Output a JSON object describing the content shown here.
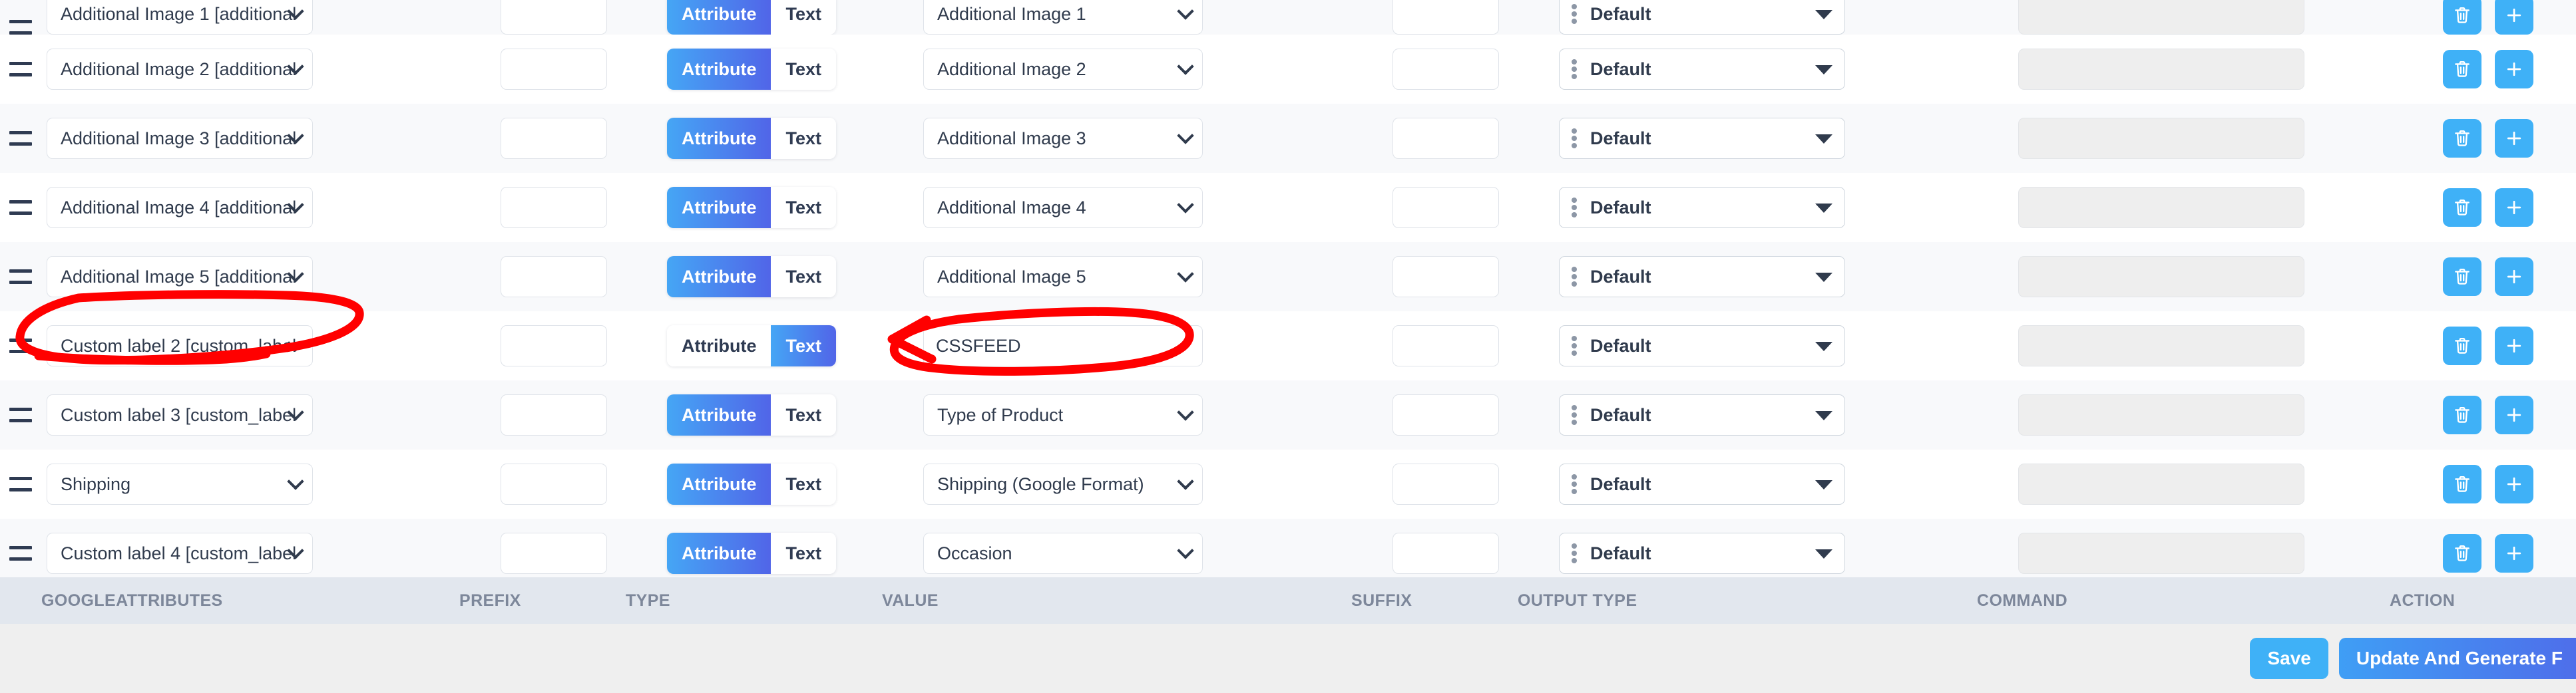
{
  "table": {
    "columns": [
      {
        "key": "attributes",
        "label": "GOOGLEATTRIBUTES"
      },
      {
        "key": "prefix",
        "label": "PREFIX"
      },
      {
        "key": "type",
        "label": "TYPE"
      },
      {
        "key": "value",
        "label": "VALUE"
      },
      {
        "key": "suffix",
        "label": "SUFFIX"
      },
      {
        "key": "output_type",
        "label": "OUTPUT TYPE"
      },
      {
        "key": "command",
        "label": "COMMAND"
      },
      {
        "key": "action",
        "label": "ACTION"
      }
    ],
    "toggle": {
      "attribute_label": "Attribute",
      "text_label": "Text"
    },
    "output_type_default": "Default",
    "rows": [
      {
        "attribute": "Additional Image 1 [additional",
        "prefix": "",
        "type_active": "Attribute",
        "value": "Additional Image 1",
        "value_kind": "select",
        "suffix": "",
        "output_type": "Default",
        "command": ""
      },
      {
        "attribute": "Additional Image 2 [additional",
        "prefix": "",
        "type_active": "Attribute",
        "value": "Additional Image 2",
        "value_kind": "select",
        "suffix": "",
        "output_type": "Default",
        "command": ""
      },
      {
        "attribute": "Additional Image 3 [additional",
        "prefix": "",
        "type_active": "Attribute",
        "value": "Additional Image 3",
        "value_kind": "select",
        "suffix": "",
        "output_type": "Default",
        "command": ""
      },
      {
        "attribute": "Additional Image 4 [additional",
        "prefix": "",
        "type_active": "Attribute",
        "value": "Additional Image 4",
        "value_kind": "select",
        "suffix": "",
        "output_type": "Default",
        "command": ""
      },
      {
        "attribute": "Additional Image 5 [additional",
        "prefix": "",
        "type_active": "Attribute",
        "value": "Additional Image 5",
        "value_kind": "select",
        "suffix": "",
        "output_type": "Default",
        "command": ""
      },
      {
        "attribute": "Custom label 2 [custom_label",
        "prefix": "",
        "type_active": "Text",
        "value": "CSSFEED",
        "value_kind": "input",
        "suffix": "",
        "output_type": "Default",
        "command": ""
      },
      {
        "attribute": "Custom label 3 [custom_label",
        "prefix": "",
        "type_active": "Attribute",
        "value": "Type of Product",
        "value_kind": "select",
        "suffix": "",
        "output_type": "Default",
        "command": ""
      },
      {
        "attribute": "Shipping",
        "prefix": "",
        "type_active": "Attribute",
        "value": "Shipping (Google Format)",
        "value_kind": "select",
        "suffix": "",
        "output_type": "Default",
        "command": ""
      },
      {
        "attribute": "Custom label 4 [custom_label",
        "prefix": "",
        "type_active": "Attribute",
        "value": "Occasion",
        "value_kind": "select",
        "suffix": "",
        "output_type": "Default",
        "command": ""
      }
    ]
  },
  "footer": {
    "save_label": "Save",
    "update_label": "Update And Generate F"
  },
  "icons": {
    "drag_handle": "drag-handle-icon",
    "delete": "trash-icon",
    "add": "plus-icon"
  },
  "colors": {
    "accent": "#3fb1f7",
    "gradient_start": "#45a6f5",
    "gradient_end": "#5165e8",
    "annotation": "#ff0000",
    "row_alt": "#f8f9fb",
    "header_band": "#e2e7ee",
    "footer": "#efefef"
  },
  "annotations": [
    {
      "name": "custom-label-2-circle",
      "shape": "hand-drawn-ellipse",
      "color": "#ff0000"
    },
    {
      "name": "cssfeed-value-circle",
      "shape": "hand-drawn-ellipse-with-arrow",
      "color": "#ff0000"
    }
  ]
}
